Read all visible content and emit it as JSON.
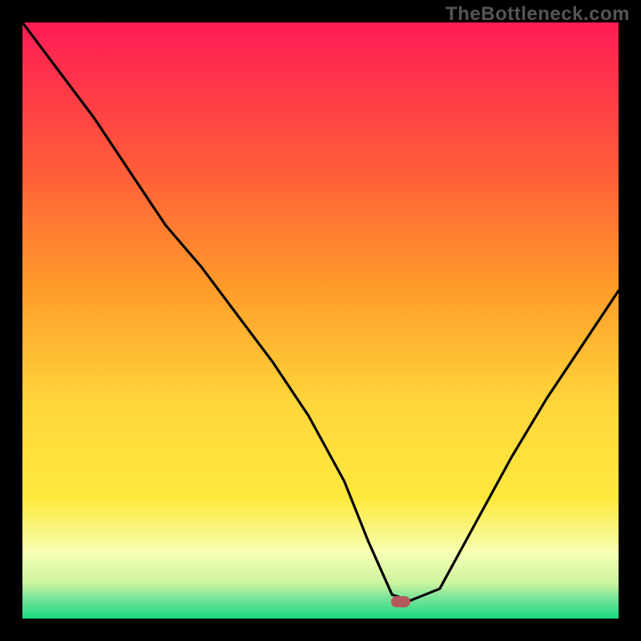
{
  "watermark": "TheBottleneck.com",
  "colors": {
    "top": "#ff1b55",
    "orange": "#ff8a2a",
    "yellow": "#ffe93e",
    "pale": "#f6ffb3",
    "green": "#17d97f",
    "line": "#000000",
    "marker": "#b55a5a",
    "frame": "#000000"
  },
  "chart_data": {
    "type": "line",
    "title": "",
    "xlabel": "",
    "ylabel": "",
    "xlim": [
      0,
      1
    ],
    "ylim": [
      0,
      1
    ],
    "x": [
      0.0,
      0.06,
      0.12,
      0.18,
      0.24,
      0.3,
      0.36,
      0.42,
      0.48,
      0.54,
      0.58,
      0.62,
      0.65,
      0.7,
      0.76,
      0.82,
      0.88,
      0.94,
      1.0
    ],
    "values": [
      1.0,
      0.92,
      0.84,
      0.75,
      0.66,
      0.59,
      0.51,
      0.43,
      0.34,
      0.23,
      0.13,
      0.04,
      0.03,
      0.05,
      0.16,
      0.27,
      0.37,
      0.46,
      0.55
    ],
    "marker": {
      "x": 0.635,
      "y": 0.028
    },
    "gradient_bands": [
      {
        "y0": 0.0,
        "y1": 0.03,
        "color": "#17d97f"
      },
      {
        "y0": 0.03,
        "y1": 0.07,
        "color": "#b8f07f"
      },
      {
        "y0": 0.07,
        "y1": 0.14,
        "color": "#f6ffb3"
      },
      {
        "y0": 0.14,
        "y1": 0.4,
        "color": "#ffe93e"
      },
      {
        "y0": 0.4,
        "y1": 0.7,
        "color": "#ff8a2a"
      },
      {
        "y0": 0.7,
        "y1": 1.0,
        "color": "#ff1b55"
      }
    ]
  }
}
